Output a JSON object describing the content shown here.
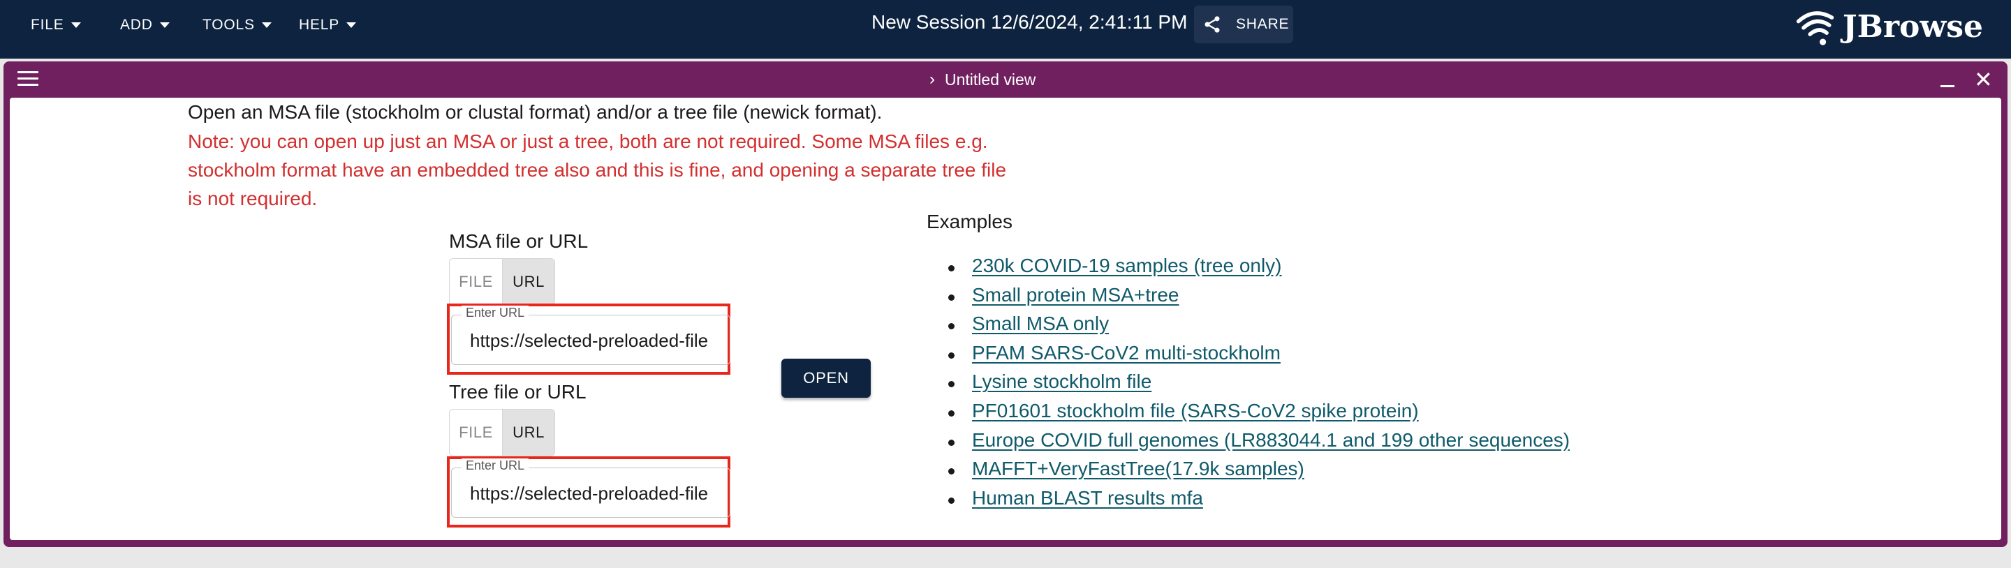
{
  "appbar": {
    "menus": [
      "FILE",
      "ADD",
      "TOOLS",
      "HELP"
    ],
    "session_title": "New Session 12/6/2024, 2:41:11 PM",
    "share_label": "SHARE",
    "logo_text": "JBrowse",
    "background_color": "#0d233f"
  },
  "view": {
    "title": "Untitled view",
    "header_color": "#70205f"
  },
  "form": {
    "intro": "Open an MSA file (stockholm or clustal format) and/or a tree file (newick format).",
    "note": "Note: you can open up just an MSA or just a tree, both are not required. Some MSA files e.g. stockholm format have an embedded tree also and this is fine, and opening a separate tree file is not required.",
    "msa_label": "MSA file or URL",
    "tree_label": "Tree file or URL",
    "toggle_file": "FILE",
    "toggle_url": "URL",
    "url_legend": "Enter URL",
    "msa_url_value": "https://selected-preloaded-file",
    "tree_url_value": "https://selected-preloaded-file",
    "open_label": "OPEN"
  },
  "examples": {
    "title": "Examples",
    "items": [
      "230k COVID-19 samples (tree only)",
      "Small protein MSA+tree",
      "Small MSA only",
      "PFAM SARS-CoV2 multi-stockholm",
      "Lysine stockholm file",
      "PF01601 stockholm file (SARS-CoV2 spike protein)",
      "Europe COVID full genomes (LR883044.1 and 199 other sequences)",
      "MAFFT+VeryFastTree(17.9k samples)",
      "Human BLAST results mfa"
    ]
  }
}
